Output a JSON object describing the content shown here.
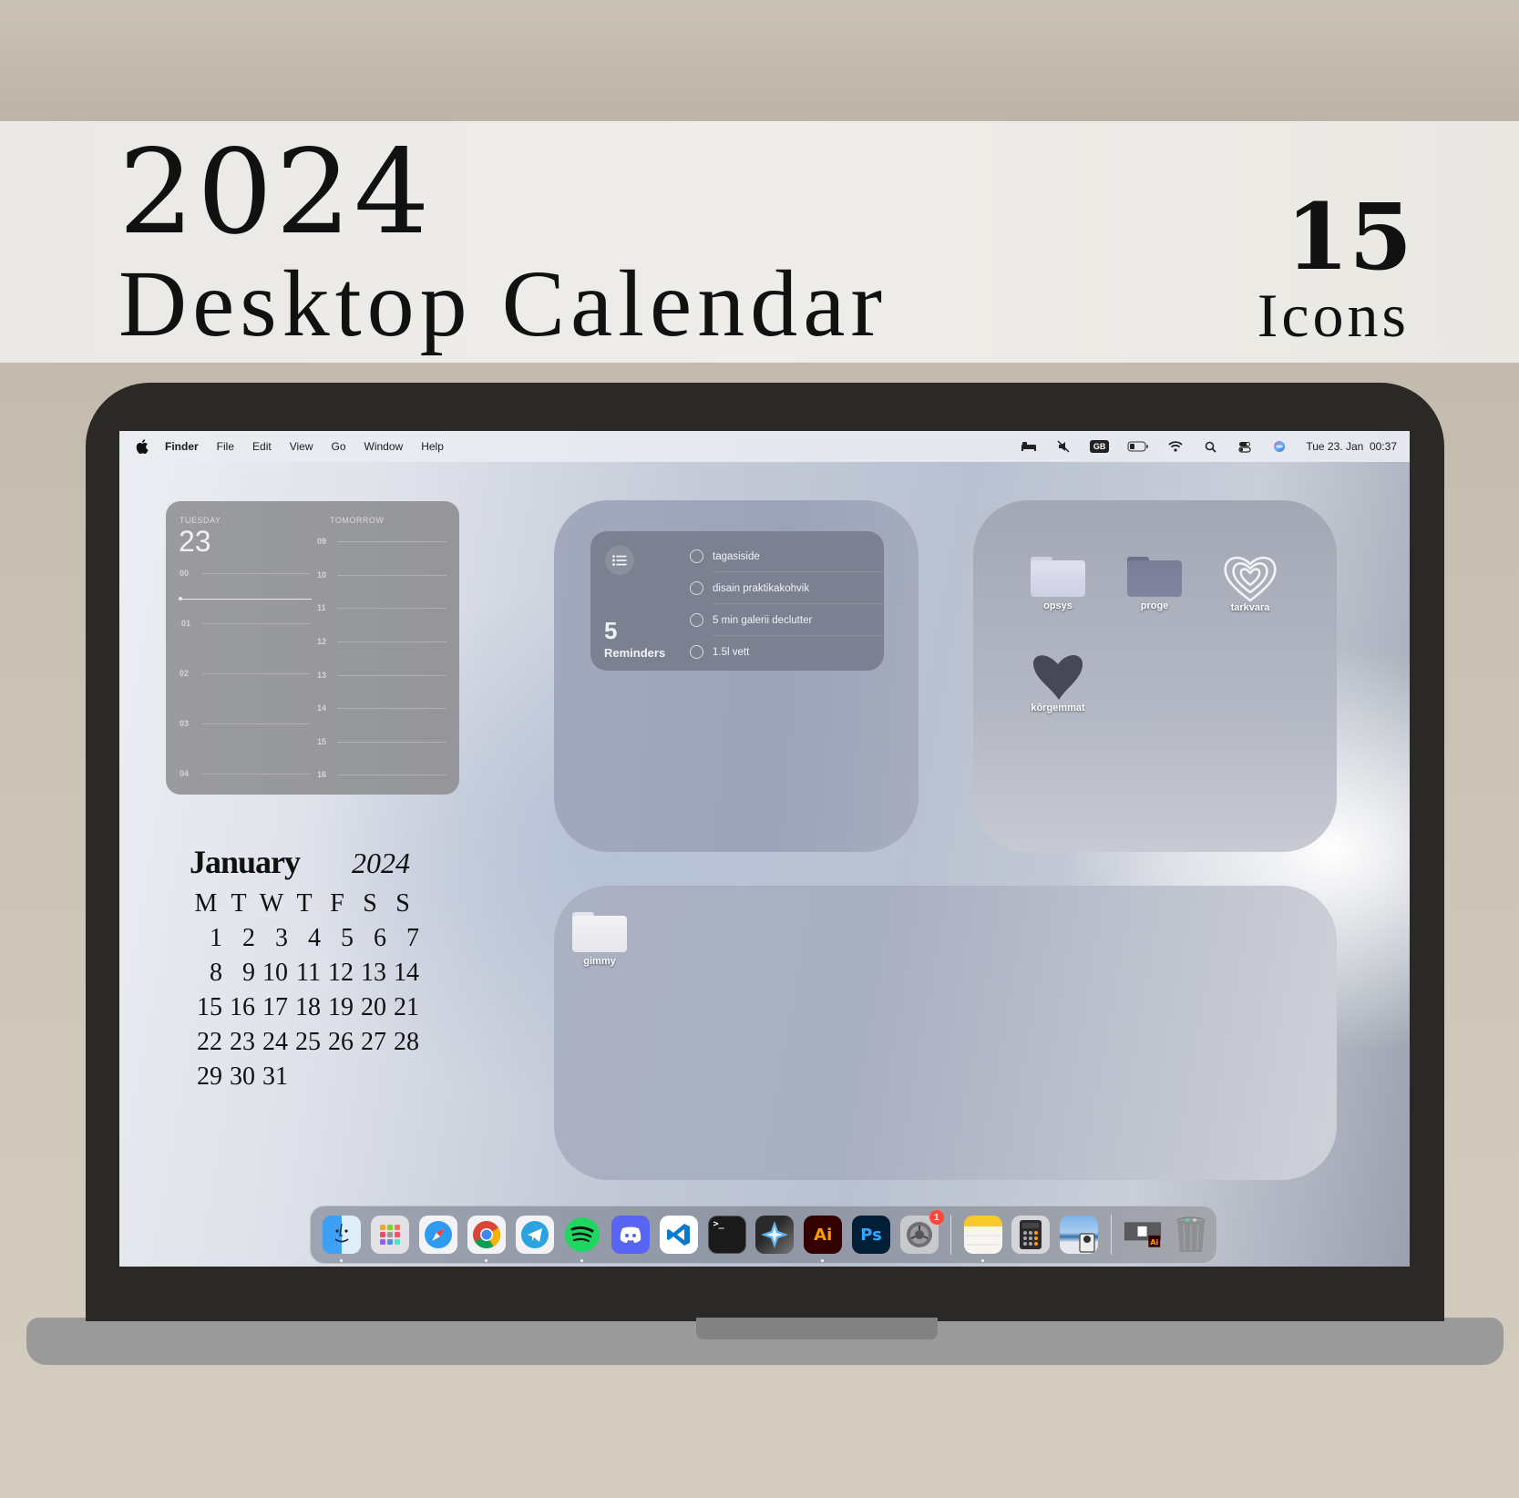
{
  "banner": {
    "year": "2024",
    "title": "Desktop Calendar",
    "icons_count": "15",
    "icons_label": "Icons"
  },
  "menubar": {
    "apple_icon": "apple-icon",
    "app_name": "Finder",
    "menus": [
      "File",
      "Edit",
      "View",
      "Go",
      "Window",
      "Help"
    ],
    "status_icons": [
      "sleep-bed-icon",
      "mute-icon",
      "keyboard-layout-icon",
      "battery-icon",
      "wifi-icon",
      "search-icon",
      "control-center-icon",
      "siri-icon"
    ],
    "keyboard_layout": "GB",
    "clock": "Tue 23. Jan  00:37"
  },
  "calendar_widget": {
    "today_label": "TUESDAY",
    "today_date": "23",
    "tomorrow_label": "TOMORROW",
    "today_hours": [
      "00",
      "01",
      "02",
      "03",
      "04"
    ],
    "tomorrow_hours": [
      "09",
      "10",
      "11",
      "12",
      "13",
      "14",
      "15",
      "16"
    ]
  },
  "reminders": {
    "count": "5",
    "label": "Reminders",
    "icon": "list-icon",
    "items": [
      "tagasiside",
      "disain praktikakohvik",
      "5 min galerii declutter",
      "1.5l vett"
    ]
  },
  "desktop_icons": [
    {
      "label": "opsys",
      "type": "folder",
      "color": "#d4d6e8"
    },
    {
      "label": "proge",
      "type": "folder",
      "color": "#7b7f99"
    },
    {
      "label": "tarkvara",
      "type": "heart-outline"
    },
    {
      "label": "kõrgemmat",
      "type": "heart-filled",
      "color": "#474856"
    },
    {
      "label": "gimmy",
      "type": "folder",
      "color": "#eeeef2"
    }
  ],
  "month_calendar": {
    "month": "January",
    "year": "2024",
    "weekdays": [
      "M",
      "T",
      "W",
      "T",
      "F",
      "S",
      "S"
    ],
    "first_weekday_offset": 0,
    "days": [
      "1",
      "2",
      "3",
      "4",
      "5",
      "6",
      "7",
      "8",
      "9",
      "10",
      "11",
      "12",
      "13",
      "14",
      "15",
      "16",
      "17",
      "18",
      "19",
      "20",
      "21",
      "22",
      "23",
      "24",
      "25",
      "26",
      "27",
      "28",
      "29",
      "30",
      "31"
    ]
  },
  "dock": {
    "apps": [
      {
        "name": "Finder",
        "icon": "finder-icon",
        "running": true
      },
      {
        "name": "Launchpad",
        "icon": "launchpad-icon",
        "running": false
      },
      {
        "name": "Safari",
        "icon": "safari-icon",
        "running": false
      },
      {
        "name": "Chrome",
        "icon": "chrome-icon",
        "running": true
      },
      {
        "name": "Telegram",
        "icon": "telegram-icon",
        "running": false
      },
      {
        "name": "Spotify",
        "icon": "spotify-icon",
        "running": true
      },
      {
        "name": "Discord",
        "icon": "discord-icon",
        "running": false
      },
      {
        "name": "Visual Studio Code",
        "icon": "vscode-icon",
        "running": false
      },
      {
        "name": "Terminal",
        "icon": "terminal-icon",
        "running": false
      },
      {
        "name": "Xcode Cloud / Star",
        "icon": "star-app-icon",
        "running": false
      },
      {
        "name": "Illustrator",
        "icon": "illustrator-icon",
        "label": "Ai",
        "running": true
      },
      {
        "name": "Photoshop",
        "icon": "photoshop-icon",
        "label": "Ps",
        "running": false
      },
      {
        "name": "System Settings",
        "icon": "system-settings-icon",
        "running": false,
        "badge": "1"
      }
    ],
    "recent_apps": [
      {
        "name": "Notes",
        "icon": "notes-icon",
        "running": true
      },
      {
        "name": "Calculator",
        "icon": "calculator-icon",
        "running": false
      },
      {
        "name": "Preview",
        "icon": "preview-icon",
        "running": false
      }
    ],
    "stack": [
      {
        "name": "Illustrator document",
        "icon": "ai-document-icon",
        "label": "Ai"
      },
      {
        "name": "Trash",
        "icon": "trash-icon"
      }
    ]
  }
}
